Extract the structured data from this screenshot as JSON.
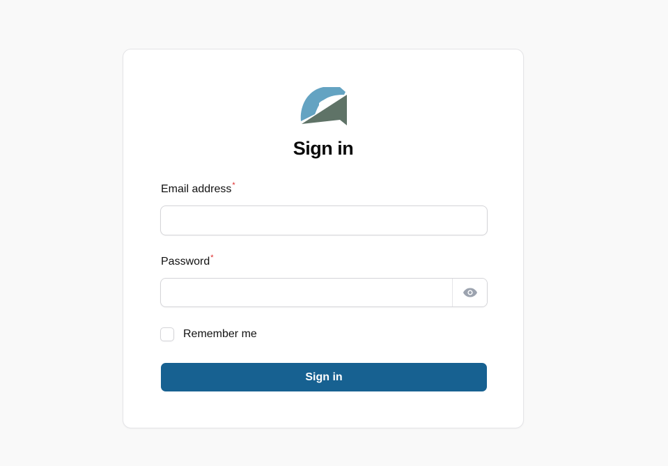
{
  "page": {
    "title": "Sign in"
  },
  "logo": {
    "icon": "brand-logo-icon",
    "colors": {
      "arc": "#64a3c2",
      "wedge": "#5f7367"
    }
  },
  "form": {
    "email": {
      "label": "Email address",
      "required_marker": "*",
      "value": ""
    },
    "password": {
      "label": "Password",
      "required_marker": "*",
      "value": "",
      "toggle_icon": "eye-icon"
    },
    "remember": {
      "label": "Remember me",
      "checked": false
    },
    "submit_label": "Sign in"
  },
  "colors": {
    "background": "#f9f9f9",
    "card": "#ffffff",
    "primary_button": "#176191",
    "required": "#dc2626"
  }
}
